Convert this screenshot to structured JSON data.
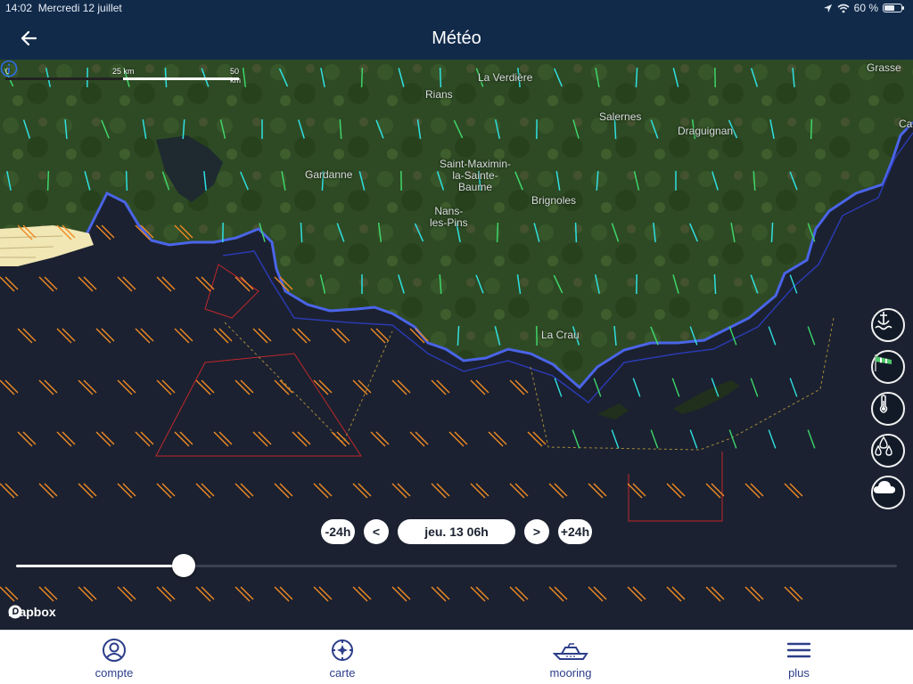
{
  "status_bar": {
    "time": "14:02",
    "date": "Mercredi 12 juillet",
    "battery": "60 %",
    "battery_level": 0.6,
    "icons": [
      "location-icon",
      "wifi-icon",
      "battery-icon"
    ]
  },
  "header": {
    "title": "Météo",
    "back_icon": "arrow-left-icon"
  },
  "map": {
    "scale": {
      "labels": [
        "0",
        "25 km",
        "50 km"
      ]
    },
    "places": [
      {
        "name": "La Verdière"
      },
      {
        "name": "Rians"
      },
      {
        "name": "Grasse"
      },
      {
        "name": "Salernes"
      },
      {
        "name": "Draguignan"
      },
      {
        "name": "Gardanne"
      },
      {
        "name": "Saint-Maximin-\nla-Sainte-\nBaume"
      },
      {
        "name": "Brignoles"
      },
      {
        "name": "Nans-\nles-Pins"
      },
      {
        "name": "La Crau"
      },
      {
        "name": "Ca"
      }
    ],
    "attribution": "mapbox"
  },
  "tools": [
    {
      "name": "anchor-wave-icon",
      "active": false
    },
    {
      "name": "windsock-icon",
      "active": true
    },
    {
      "name": "thermometer-icon",
      "active": false
    },
    {
      "name": "rain-drops-icon",
      "active": false
    },
    {
      "name": "cloud-icon",
      "active": false
    }
  ],
  "time_controls": {
    "minus_24h": "-24h",
    "prev": "<",
    "current": "jeu. 13 06h",
    "next": ">",
    "plus_24h": "+24h",
    "slider_value": 0.19
  },
  "nav": {
    "items": [
      {
        "label": "compte",
        "icon": "user-circle-icon"
      },
      {
        "label": "carte",
        "icon": "compass-icon"
      },
      {
        "label": "mooring",
        "icon": "boat-icon"
      },
      {
        "label": "plus",
        "icon": "menu-icon"
      }
    ]
  },
  "colors": {
    "header_bg": "#112a4a",
    "sea": "#1b2130",
    "wind_light": "#2fe0e0",
    "wind_moderate": "#3fd56a",
    "wind_strong": "#f08a24",
    "nav_accent": "#2c3e8a",
    "zones": "#c0272d"
  }
}
